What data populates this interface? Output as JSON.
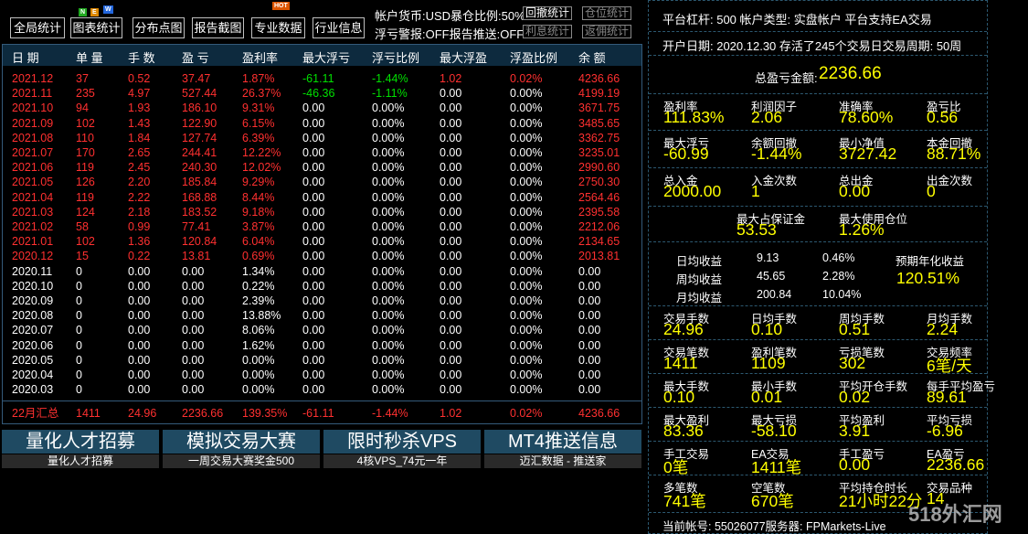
{
  "toolbar": {
    "buttons": [
      "全局统计",
      "图表统计",
      "分布点图",
      "报告截图",
      "专业数据",
      "行业信息"
    ],
    "new_badge": [
      "N",
      "E",
      "W"
    ],
    "hot_badge": "HOT"
  },
  "status": {
    "line1": "帐户货币:USD暴仓比例:50%",
    "line2": "浮亏警报:OFF报告推送:OFF",
    "btn_withdraw_stats": "回撤统计",
    "btn_position_stats": "仓位统计",
    "btn_interest_stats": "利息统计",
    "btn_rebate_stats": "返佣统计"
  },
  "table": {
    "headers": [
      "日 期",
      "单 量",
      "手 数",
      "盈 亏",
      "盈利率",
      "最大浮亏",
      "浮亏比例",
      "最大浮盈",
      "浮盈比例",
      "余 额"
    ],
    "rows": [
      [
        "2021.12",
        "37",
        "0.52",
        "37.47",
        "1.87%",
        "-61.11",
        "-1.44%",
        "1.02",
        "0.02%",
        "4236.66"
      ],
      [
        "2021.11",
        "235",
        "4.97",
        "527.44",
        "26.37%",
        "-46.36",
        "-1.11%",
        "0.00",
        "0.00%",
        "4199.19"
      ],
      [
        "2021.10",
        "94",
        "1.93",
        "186.10",
        "9.31%",
        "0.00",
        "0.00%",
        "0.00",
        "0.00%",
        "3671.75"
      ],
      [
        "2021.09",
        "102",
        "1.43",
        "122.90",
        "6.15%",
        "0.00",
        "0.00%",
        "0.00",
        "0.00%",
        "3485.65"
      ],
      [
        "2021.08",
        "110",
        "1.84",
        "127.74",
        "6.39%",
        "0.00",
        "0.00%",
        "0.00",
        "0.00%",
        "3362.75"
      ],
      [
        "2021.07",
        "170",
        "2.65",
        "244.41",
        "12.22%",
        "0.00",
        "0.00%",
        "0.00",
        "0.00%",
        "3235.01"
      ],
      [
        "2021.06",
        "119",
        "2.45",
        "240.30",
        "12.02%",
        "0.00",
        "0.00%",
        "0.00",
        "0.00%",
        "2990.60"
      ],
      [
        "2021.05",
        "126",
        "2.20",
        "185.84",
        "9.29%",
        "0.00",
        "0.00%",
        "0.00",
        "0.00%",
        "2750.30"
      ],
      [
        "2021.04",
        "119",
        "2.22",
        "168.88",
        "8.44%",
        "0.00",
        "0.00%",
        "0.00",
        "0.00%",
        "2564.46"
      ],
      [
        "2021.03",
        "124",
        "2.18",
        "183.52",
        "9.18%",
        "0.00",
        "0.00%",
        "0.00",
        "0.00%",
        "2395.58"
      ],
      [
        "2021.02",
        "58",
        "0.99",
        "77.41",
        "3.87%",
        "0.00",
        "0.00%",
        "0.00",
        "0.00%",
        "2212.06"
      ],
      [
        "2021.01",
        "102",
        "1.36",
        "120.84",
        "6.04%",
        "0.00",
        "0.00%",
        "0.00",
        "0.00%",
        "2134.65"
      ],
      [
        "2020.12",
        "15",
        "0.22",
        "13.81",
        "0.69%",
        "0.00",
        "0.00%",
        "0.00",
        "0.00%",
        "2013.81"
      ],
      [
        "2020.11",
        "0",
        "0.00",
        "0.00",
        "1.34%",
        "0.00",
        "0.00%",
        "0.00",
        "0.00%",
        "0.00"
      ],
      [
        "2020.10",
        "0",
        "0.00",
        "0.00",
        "0.22%",
        "0.00",
        "0.00%",
        "0.00",
        "0.00%",
        "0.00"
      ],
      [
        "2020.09",
        "0",
        "0.00",
        "0.00",
        "2.39%",
        "0.00",
        "0.00%",
        "0.00",
        "0.00%",
        "0.00"
      ],
      [
        "2020.08",
        "0",
        "0.00",
        "0.00",
        "13.88%",
        "0.00",
        "0.00%",
        "0.00",
        "0.00%",
        "0.00"
      ],
      [
        "2020.07",
        "0",
        "0.00",
        "0.00",
        "8.06%",
        "0.00",
        "0.00%",
        "0.00",
        "0.00%",
        "0.00"
      ],
      [
        "2020.06",
        "0",
        "0.00",
        "0.00",
        "1.62%",
        "0.00",
        "0.00%",
        "0.00",
        "0.00%",
        "0.00"
      ],
      [
        "2020.05",
        "0",
        "0.00",
        "0.00",
        "0.00%",
        "0.00",
        "0.00%",
        "0.00",
        "0.00%",
        "0.00"
      ],
      [
        "2020.04",
        "0",
        "0.00",
        "0.00",
        "0.00%",
        "0.00",
        "0.00%",
        "0.00",
        "0.00%",
        "0.00"
      ],
      [
        "2020.03",
        "0",
        "0.00",
        "0.00",
        "0.00%",
        "0.00",
        "0.00%",
        "0.00",
        "0.00%",
        "0.00"
      ]
    ],
    "summary": [
      "22月汇总",
      "1411",
      "24.96",
      "2236.66",
      "139.35%",
      "-61.11",
      "-1.44%",
      "1.02",
      "0.02%",
      "4236.66"
    ]
  },
  "promos": [
    {
      "title": "量化人才招募",
      "sub": "量化人才招募"
    },
    {
      "title": "模拟交易大赛",
      "sub": "一周交易大赛奖金500"
    },
    {
      "title": "限时秒杀VPS",
      "sub": "4核VPS_74元一年"
    },
    {
      "title": "MT4推送信息",
      "sub": "迈汇数据 - 推送家"
    }
  ],
  "account": {
    "info_line": "平台杠杆:  500    帐户类型:  实盘帐户    平台支持EA交易",
    "open_line": "开户日期:  2020.12.30  存活了245个交易日交易周期:  50周",
    "total_pl_label": "总盈亏金额:",
    "total_pl_value": "2236.66",
    "g1": [
      {
        "label": "盈利率",
        "value": "111.83%"
      },
      {
        "label": "利润因子",
        "value": "2.06"
      },
      {
        "label": "准确率",
        "value": "78.60%"
      },
      {
        "label": "盈亏比",
        "value": "0.56"
      }
    ],
    "g2": [
      {
        "label": "最大浮亏",
        "value": "-60.99"
      },
      {
        "label": "余额回撤",
        "value": "-1.44%"
      },
      {
        "label": "最小净值",
        "value": "3727.42"
      },
      {
        "label": "本金回撤",
        "value": "88.71%"
      }
    ],
    "g3": [
      {
        "label": "总入金",
        "value": "2000.00"
      },
      {
        "label": "入金次数",
        "value": "1"
      },
      {
        "label": "总出金",
        "value": "0.00"
      },
      {
        "label": "出金次数",
        "value": "0"
      }
    ],
    "g4": [
      {
        "label": "最大占保证金",
        "value": "53.53"
      },
      {
        "label": "最大使用仓位",
        "value": "1.26%"
      }
    ],
    "returns": {
      "daily_label": "日均收益",
      "daily_val": "9.13",
      "daily_pct": "0.46%",
      "weekly_label": "周均收益",
      "weekly_val": "45.65",
      "weekly_pct": "2.28%",
      "monthly_label": "月均收益",
      "monthly_val": "200.84",
      "monthly_pct": "10.04%",
      "annual_label": "预期年化收益",
      "annual_val": "120.51%"
    },
    "g5": [
      {
        "label": "交易手数",
        "value": "24.96"
      },
      {
        "label": "日均手数",
        "value": "0.10"
      },
      {
        "label": "周均手数",
        "value": "0.51"
      },
      {
        "label": "月均手数",
        "value": "2.24"
      }
    ],
    "g6": [
      {
        "label": "交易笔数",
        "value": "1411"
      },
      {
        "label": "盈利笔数",
        "value": "1109"
      },
      {
        "label": "亏损笔数",
        "value": "302"
      },
      {
        "label": "交易频率",
        "value": "6笔/天"
      }
    ],
    "g7": [
      {
        "label": "最大手数",
        "value": "0.10"
      },
      {
        "label": "最小手数",
        "value": "0.01"
      },
      {
        "label": "平均开仓手数",
        "value": "0.02"
      },
      {
        "label": "每手平均盈亏",
        "value": "89.61"
      }
    ],
    "g8": [
      {
        "label": "最大盈利",
        "value": "83.36"
      },
      {
        "label": "最大亏损",
        "value": "-58.10"
      },
      {
        "label": "平均盈利",
        "value": "3.91"
      },
      {
        "label": "平均亏损",
        "value": "-6.96"
      }
    ],
    "g9": [
      {
        "label": "手工交易",
        "value": "0笔"
      },
      {
        "label": "EA交易",
        "value": "1411笔"
      },
      {
        "label": "手工盈亏",
        "value": "0.00"
      },
      {
        "label": "EA盈亏",
        "value": "2236.66"
      }
    ],
    "g10": [
      {
        "label": "多笔数",
        "value": "741笔"
      },
      {
        "label": "空笔数",
        "value": "670笔"
      },
      {
        "label": "平均持仓时长",
        "value": "21小时22分"
      },
      {
        "label": "交易品种",
        "value": "14"
      }
    ],
    "footer": "当前帐号:  55026077服务器:  FPMarkets-Live"
  },
  "watermark": "518外汇网",
  "colors": {
    "positive": "#ff3030",
    "negative": "#00e000",
    "highlight": "#ffff00",
    "header_bg": "#0d2a3e",
    "promo_bg": "#1f4a62"
  }
}
